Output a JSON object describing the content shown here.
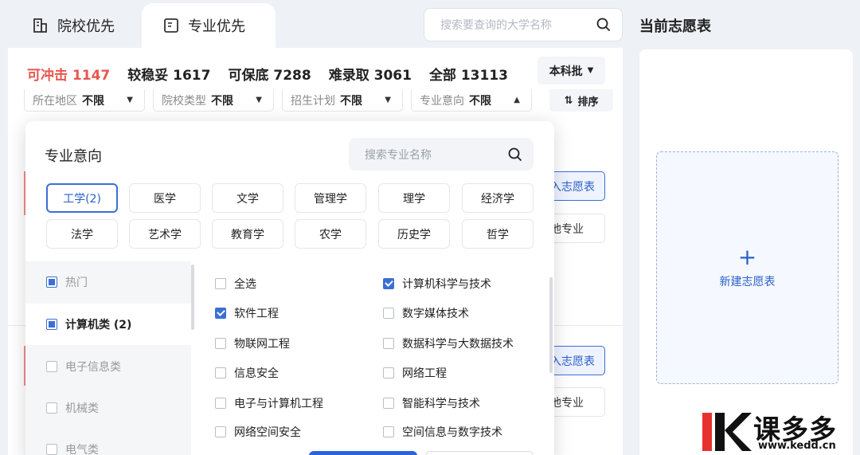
{
  "tabs": {
    "school": "院校优先",
    "major": "专业优先"
  },
  "search": {
    "placeholder": "搜索要查询的大学名称"
  },
  "current_list_title": "当前志愿表",
  "stats": [
    {
      "label": "可冲击 1147"
    },
    {
      "label": "较稳妥 1617"
    },
    {
      "label": "可保底 7288"
    },
    {
      "label": "难录取 3061"
    },
    {
      "label": "全部 13113"
    }
  ],
  "batch": "本科批",
  "filters": [
    {
      "label": "所在地区",
      "value": "不限"
    },
    {
      "label": "院校类型",
      "value": "不限"
    },
    {
      "label": "招生计划",
      "value": "不限"
    },
    {
      "label": "专业意向",
      "value": "不限"
    }
  ],
  "sort_label": "排序",
  "bg_buttons": {
    "add_1": "入志愿表",
    "other_1": "他专业",
    "add_2": "入志愿表",
    "other_2": "他专业"
  },
  "new_list": "新建志愿表",
  "popup": {
    "title": "专业意向",
    "search_placeholder": "搜索专业名称",
    "categories": [
      "工学(2)",
      "医学",
      "文学",
      "管理学",
      "理学",
      "经济学",
      "法学",
      "艺术学",
      "教育学",
      "农学",
      "历史学",
      "哲学"
    ],
    "groups": [
      {
        "label": "热门"
      },
      {
        "label": "计算机类",
        "count": "2"
      },
      {
        "label": "电子信息类"
      },
      {
        "label": "机械类"
      },
      {
        "label": "电气类"
      }
    ],
    "majors": [
      "全选",
      "计算机科学与技术",
      "软件工程",
      "数字媒体技术",
      "物联网工程",
      "数据科学与大数据技术",
      "信息安全",
      "网络工程",
      "电子与计算机工程",
      "智能科学与技术",
      "网络空间安全",
      "空间信息与数字技术"
    ]
  },
  "logo": {
    "text": "课多多",
    "url": "www.kedd.cn"
  },
  "colors": {
    "accent": "#3b6fd6",
    "hot": "#e8564f"
  }
}
